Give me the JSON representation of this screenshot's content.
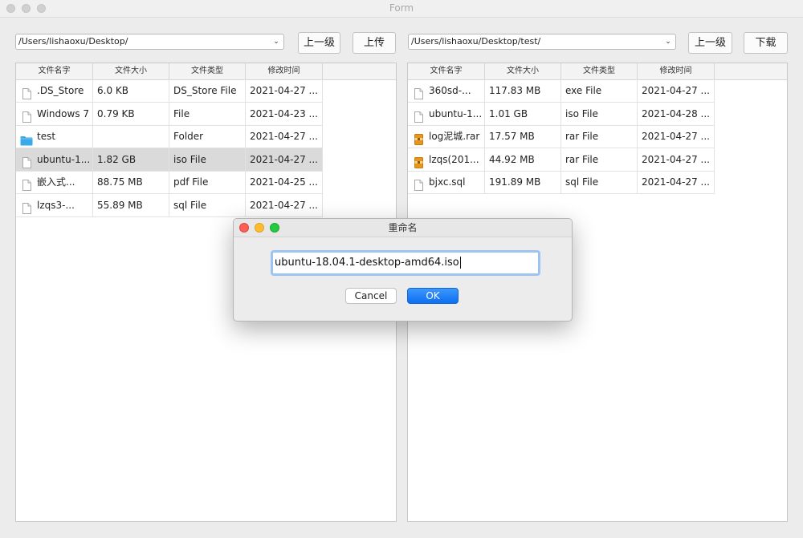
{
  "window": {
    "title": "Form"
  },
  "left": {
    "path": "/Users/lishaoxu/Desktop/",
    "up_label": "上一级",
    "action_label": "上传",
    "columns": [
      "文件名字",
      "文件大小",
      "文件类型",
      "修改时间"
    ],
    "rows": [
      {
        "name": ".DS_Store",
        "size": "6.0  KB",
        "type": "DS_Store File",
        "mtime": "2021-04-27 ...",
        "icon": "file-icon"
      },
      {
        "name": "Windows 7",
        "size": "0.79  KB",
        "type": "File",
        "mtime": "2021-04-23 ...",
        "icon": "file-icon"
      },
      {
        "name": "test",
        "size": "",
        "type": "Folder",
        "mtime": "2021-04-27 ...",
        "icon": "folder-icon"
      },
      {
        "name": "ubuntu-1...",
        "size": "1.82 GB",
        "type": "iso File",
        "mtime": "2021-04-27 ...",
        "icon": "file-icon"
      },
      {
        "name": "嵌入式...",
        "size": "88.75  MB",
        "type": "pdf File",
        "mtime": "2021-04-25 ...",
        "icon": "file-icon"
      },
      {
        "name": "lzqs3-...",
        "size": "55.89  MB",
        "type": "sql File",
        "mtime": "2021-04-27 ...",
        "icon": "file-icon"
      }
    ]
  },
  "right": {
    "path": "/Users/lishaoxu/Desktop/test/",
    "up_label": "上一级",
    "action_label": "下载",
    "columns": [
      "文件名字",
      "文件大小",
      "文件类型",
      "修改时间"
    ],
    "rows": [
      {
        "name": "360sd-...",
        "size": "117.83  MB",
        "type": "exe File",
        "mtime": "2021-04-27 ...",
        "icon": "file-icon"
      },
      {
        "name": "ubuntu-1...",
        "size": "1.01 GB",
        "type": "iso File",
        "mtime": "2021-04-28 ...",
        "icon": "file-icon"
      },
      {
        "name": "log泥城.rar",
        "size": "17.57  MB",
        "type": "rar File",
        "mtime": "2021-04-27 ...",
        "icon": "archive-icon"
      },
      {
        "name": "lzqs(201...",
        "size": "44.92  MB",
        "type": "rar File",
        "mtime": "2021-04-27 ...",
        "icon": "archive-icon"
      },
      {
        "name": "bjxc.sql",
        "size": "191.89  MB",
        "type": "sql File",
        "mtime": "2021-04-27 ...",
        "icon": "file-icon"
      }
    ]
  },
  "dialog": {
    "title": "重命名",
    "input_value": "ubuntu-18.04.1-desktop-amd64.iso",
    "cancel_label": "Cancel",
    "ok_label": "OK"
  },
  "colors": {
    "accent": "#0c6ff3",
    "selection": "#dadada",
    "folder": "#39a9e8",
    "archive": "#e8951c"
  }
}
